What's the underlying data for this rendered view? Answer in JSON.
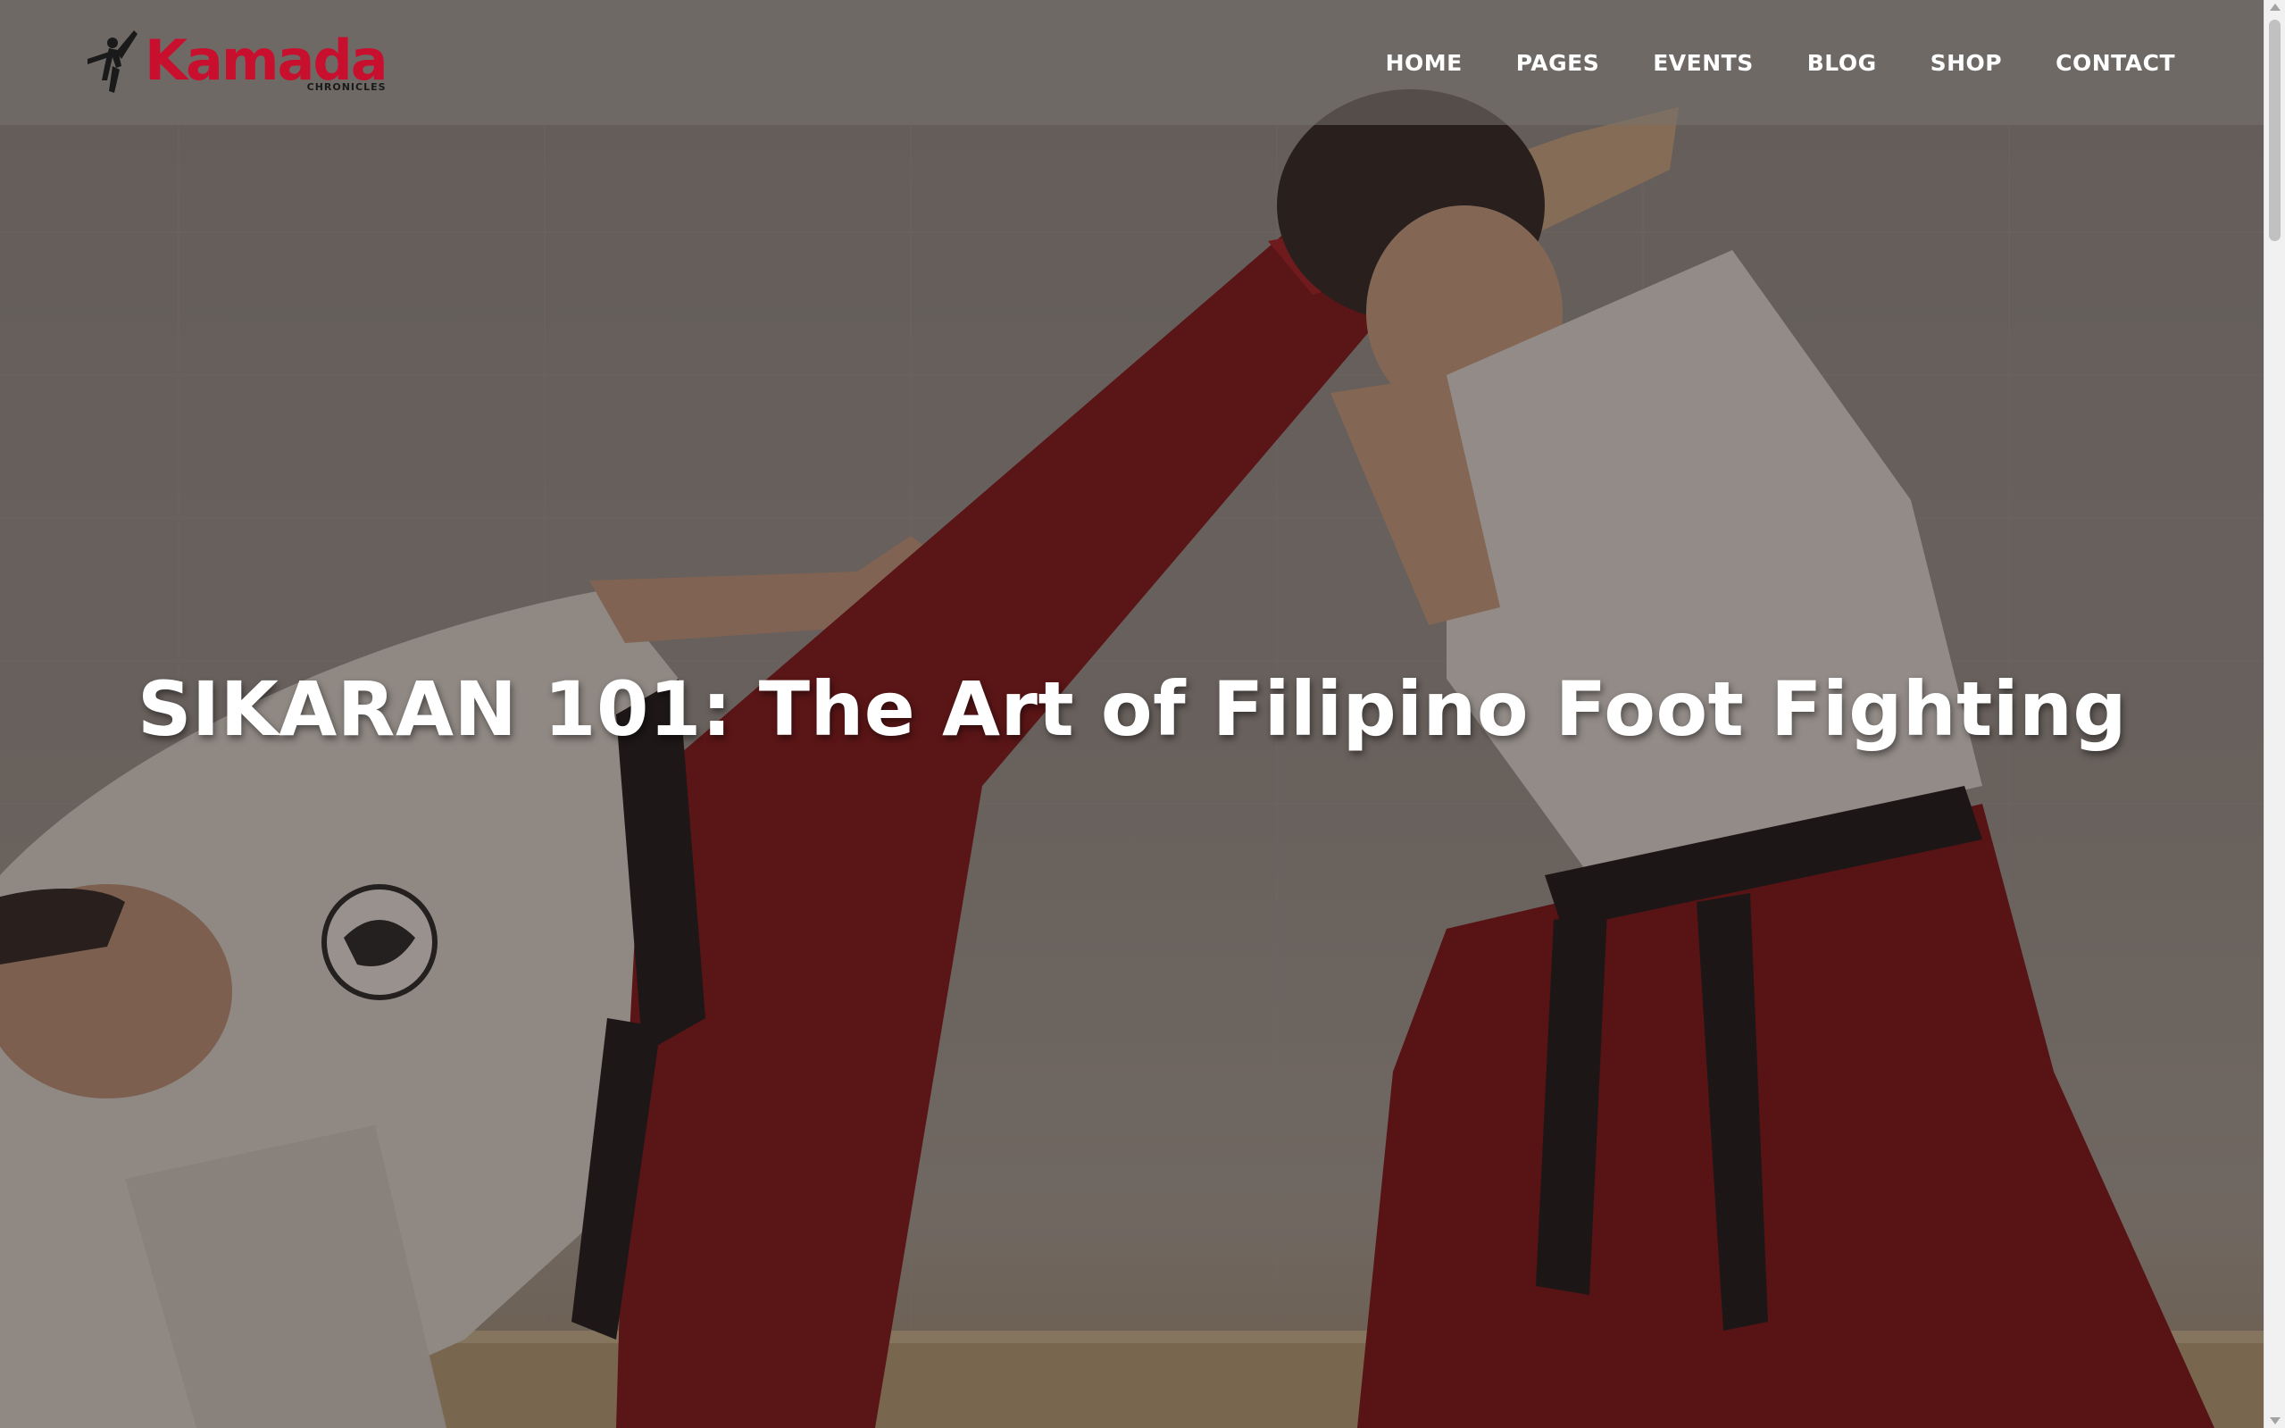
{
  "brand": {
    "logo_word": "Kamada",
    "logo_sub": "CHRONICLES",
    "logo_icon": "karateka-kick-icon",
    "accent_color": "#c8102e"
  },
  "nav": {
    "items": [
      {
        "label": "HOME"
      },
      {
        "label": "PAGES"
      },
      {
        "label": "EVENTS"
      },
      {
        "label": "BLOG"
      },
      {
        "label": "SHOP"
      },
      {
        "label": "CONTACT"
      }
    ]
  },
  "hero": {
    "title": "SIKARAN 101: The Art of Filipino Foot Fighting",
    "image_alt_icon": "martial-arts-photo"
  }
}
